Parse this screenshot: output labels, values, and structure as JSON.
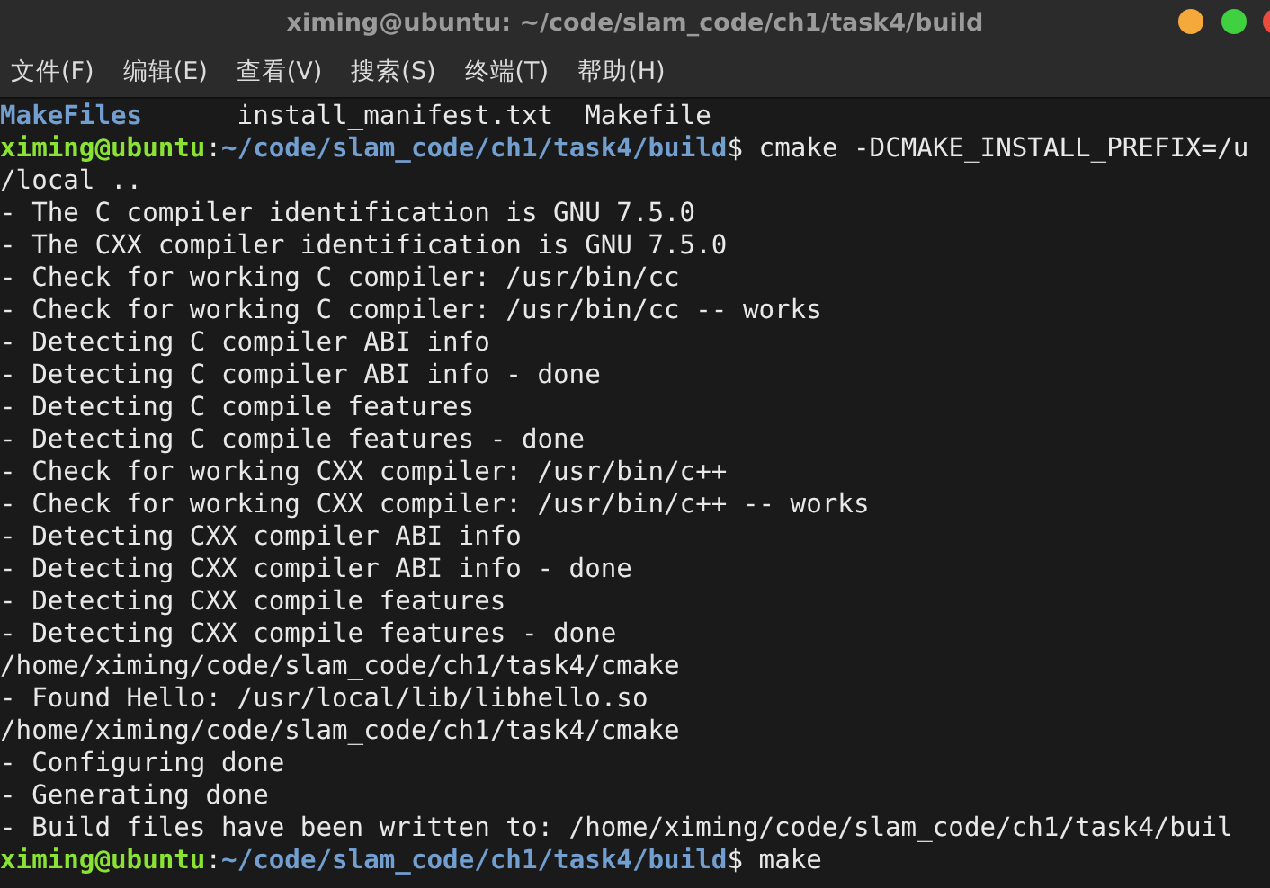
{
  "window": {
    "title": "ximing@ubuntu: ~/code/slam_code/ch1/task4/build"
  },
  "menu": [
    "文件(F)",
    "编辑(E)",
    "查看(V)",
    "搜索(S)",
    "终端(T)",
    "帮助(H)"
  ],
  "terminal": {
    "lines": [
      {
        "kind": "ls",
        "items": [
          {
            "text": "MakeFiles",
            "is_dir": true
          },
          {
            "text": "install_manifest.txt",
            "is_dir": false
          },
          {
            "text": "Makefile",
            "is_dir": false
          }
        ]
      },
      {
        "kind": "prompt",
        "user": "ximing@ubuntu",
        "separator": ":",
        "path": "~/code/slam_code/ch1/task4/build",
        "symbol": "$",
        "command": "cmake -DCMAKE_INSTALL_PREFIX=/u"
      },
      {
        "kind": "output",
        "text": "/local .."
      },
      {
        "kind": "output",
        "text": "- The C compiler identification is GNU 7.5.0"
      },
      {
        "kind": "output",
        "text": "- The CXX compiler identification is GNU 7.5.0"
      },
      {
        "kind": "output",
        "text": "- Check for working C compiler: /usr/bin/cc"
      },
      {
        "kind": "output",
        "text": "- Check for working C compiler: /usr/bin/cc -- works"
      },
      {
        "kind": "output",
        "text": "- Detecting C compiler ABI info"
      },
      {
        "kind": "output",
        "text": "- Detecting C compiler ABI info - done"
      },
      {
        "kind": "output",
        "text": "- Detecting C compile features"
      },
      {
        "kind": "output",
        "text": "- Detecting C compile features - done"
      },
      {
        "kind": "output",
        "text": "- Check for working CXX compiler: /usr/bin/c++"
      },
      {
        "kind": "output",
        "text": "- Check for working CXX compiler: /usr/bin/c++ -- works"
      },
      {
        "kind": "output",
        "text": "- Detecting CXX compiler ABI info"
      },
      {
        "kind": "output",
        "text": "- Detecting CXX compiler ABI info - done"
      },
      {
        "kind": "output",
        "text": "- Detecting CXX compile features"
      },
      {
        "kind": "output",
        "text": "- Detecting CXX compile features - done"
      },
      {
        "kind": "output",
        "text": "/home/ximing/code/slam_code/ch1/task4/cmake"
      },
      {
        "kind": "output",
        "text": "- Found Hello: /usr/local/lib/libhello.so"
      },
      {
        "kind": "output",
        "text": "/home/ximing/code/slam_code/ch1/task4/cmake"
      },
      {
        "kind": "output",
        "text": "- Configuring done"
      },
      {
        "kind": "output",
        "text": "- Generating done"
      },
      {
        "kind": "output",
        "text": "- Build files have been written to: /home/ximing/code/slam_code/ch1/task4/buil"
      },
      {
        "kind": "prompt",
        "user": "ximing@ubuntu",
        "separator": ":",
        "path": "~/code/slam_code/ch1/task4/build",
        "symbol": "$",
        "command": "make"
      }
    ]
  }
}
